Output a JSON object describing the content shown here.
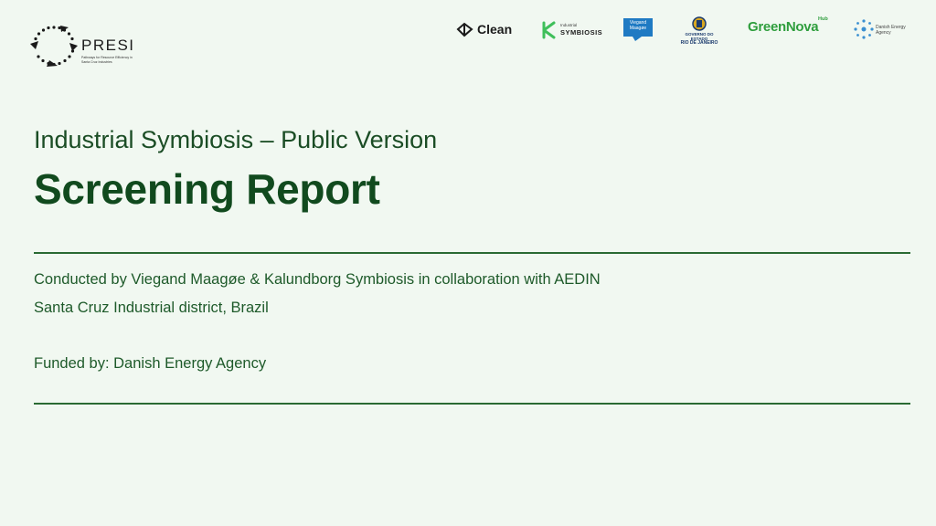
{
  "logo": {
    "name": "PRESI",
    "tagline": "Pathways for Resource Efficiency in Santa Cruz Industries"
  },
  "partners": {
    "clean": "Clean",
    "symbiosis_top": "Industrial",
    "symbiosis": "SYMBIOSIS",
    "viegand_line1": "Viegand",
    "viegand_line2": "Maagøe",
    "rj_line1": "GOVERNO DO ESTADO",
    "rj_line2": "RIO DE JANEIRO",
    "greennova": "GreenNova",
    "greennova_hub": "Hub",
    "dea_line1": "Danish Energy",
    "dea_line2": "Agency"
  },
  "header": {
    "subtitle": "Industrial Symbiosis – Public Version",
    "title": "Screening Report"
  },
  "body": {
    "conducted": "Conducted by Viegand Maagøe & Kalundborg Symbiosis in collaboration with AEDIN",
    "location": "Santa Cruz Industrial district, Brazil",
    "funded": "Funded by: Danish Energy Agency"
  },
  "colors": {
    "background": "#f1f8f1",
    "title": "#114a1e",
    "text": "#1e5a2a",
    "rule": "#2a6a33"
  }
}
